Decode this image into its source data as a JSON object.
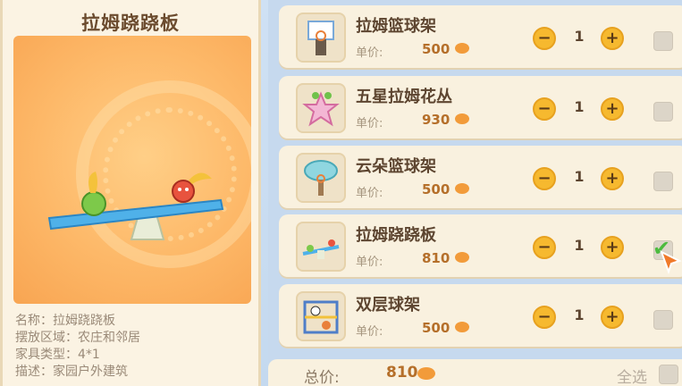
{
  "detail": {
    "title": "拉姆跷跷板",
    "info": [
      "名称：拉姆跷跷板",
      "摆放区域：农庄和邻居",
      "家具类型：4*1",
      "描述：家园户外建筑"
    ]
  },
  "items": [
    {
      "name": "拉姆篮球架",
      "price_label": "单价:",
      "price": "500",
      "qty": "1",
      "selected": false
    },
    {
      "name": "五星拉姆花丛",
      "price_label": "单价:",
      "price": "930",
      "qty": "1",
      "selected": false
    },
    {
      "name": "云朵篮球架",
      "price_label": "单价:",
      "price": "500",
      "qty": "1",
      "selected": false
    },
    {
      "name": "拉姆跷跷板",
      "price_label": "单价:",
      "price": "810",
      "qty": "1",
      "selected": true
    },
    {
      "name": "双层球架",
      "price_label": "单价:",
      "price": "500",
      "qty": "1",
      "selected": false
    }
  ],
  "controls": {
    "minus": "−",
    "plus": "+",
    "check": "✔"
  },
  "footer": {
    "total_label": "总价:",
    "total_value": "810",
    "select_all": "全选"
  },
  "colors": {
    "accent": "#f6b92f",
    "check": "#4cbb3e",
    "price": "#b56f2a"
  },
  "icons": [
    "coin-icon",
    "check-icon",
    "cursor-arrow-icon"
  ]
}
